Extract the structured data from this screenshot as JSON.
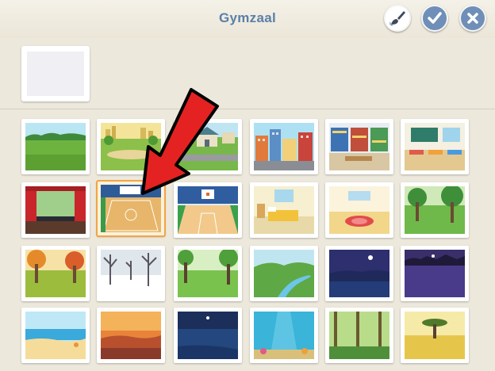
{
  "header": {
    "title": "Gymzaal",
    "buttons": [
      {
        "name": "paint-button",
        "icon": "paintbrush-icon"
      },
      {
        "name": "confirm-button",
        "icon": "check-icon"
      },
      {
        "name": "close-button",
        "icon": "close-icon"
      }
    ]
  },
  "selected_background": {
    "name": "selected-background-preview"
  },
  "backgrounds": [
    "meadow",
    "city-park",
    "suburb-houses",
    "city-street",
    "library",
    "classroom",
    "theater-stage",
    "gym",
    "basketball-court",
    "bedroom",
    "empty-room",
    "forest",
    "autumn-forest",
    "winter-forest",
    "spring-forest",
    "river-valley",
    "night-lake",
    "night-field",
    "beach",
    "desert-sunset",
    "night-ocean",
    "underwater",
    "jungle",
    "savanna"
  ],
  "selected_index": 7,
  "colors": {
    "accent": "#6f8fb8",
    "selected_border": "#f2a445",
    "arrow": "#e52222"
  }
}
